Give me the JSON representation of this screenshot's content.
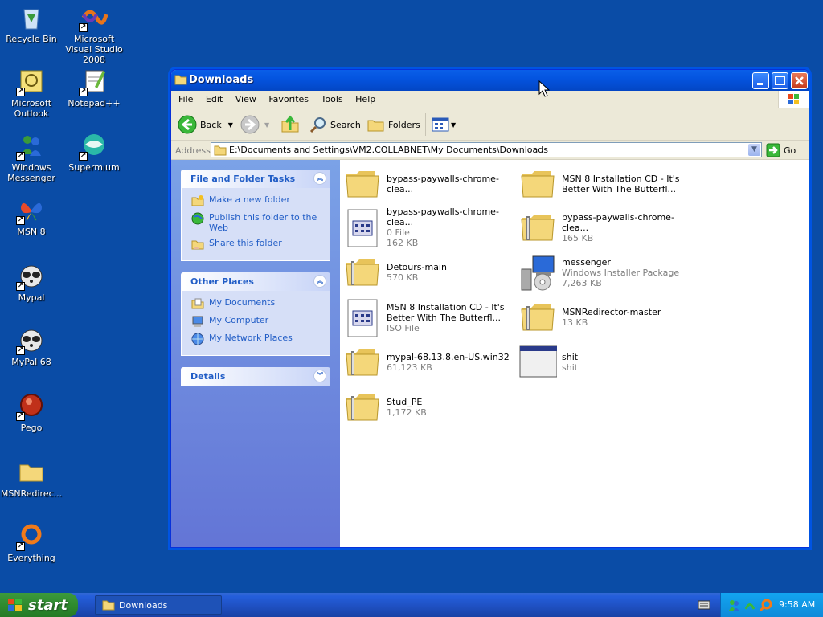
{
  "desktop": {
    "icons": [
      {
        "label": "Recycle Bin",
        "icon": "recycle-bin-icon"
      },
      {
        "label": "Microsoft Visual Studio 2008",
        "icon": "visual-studio-icon"
      },
      {
        "label": "Microsoft Outlook",
        "icon": "outlook-icon"
      },
      {
        "label": "Notepad++",
        "icon": "notepad-plus-plus-icon"
      },
      {
        "label": "Windows Messenger",
        "icon": "windows-messenger-icon"
      },
      {
        "label": "Supermium",
        "icon": "supermium-icon"
      },
      {
        "label": "MSN 8",
        "icon": "msn-butterfly-icon"
      },
      {
        "label": "Mypal",
        "icon": "mypal-raccoon-icon"
      },
      {
        "label": "MyPal 68",
        "icon": "mypal-raccoon-icon"
      },
      {
        "label": "Pego",
        "icon": "pego-icon"
      },
      {
        "label": "MSNRedirec...",
        "icon": "folder-icon"
      },
      {
        "label": "Everything",
        "icon": "everything-search-icon"
      }
    ]
  },
  "window": {
    "title": "Downloads",
    "menu": [
      "File",
      "Edit",
      "View",
      "Favorites",
      "Tools",
      "Help"
    ],
    "toolbar": {
      "back": "Back",
      "search": "Search",
      "folders": "Folders"
    },
    "address": {
      "label": "Address",
      "value": "E:\\Documents and Settings\\VM2.COLLABNET\\My Documents\\Downloads",
      "go": "Go"
    },
    "tasks_panel": {
      "title": "File and Folder Tasks",
      "items": [
        "Make a new folder",
        "Publish this folder to the Web",
        "Share this folder"
      ]
    },
    "places_panel": {
      "title": "Other Places",
      "items": [
        "My Documents",
        "My Computer",
        "My Network Places"
      ]
    },
    "details_panel": {
      "title": "Details"
    },
    "files": [
      {
        "name": "bypass-paywalls-chrome-clea...",
        "sub1": "",
        "sub2": "",
        "kind": "folder"
      },
      {
        "name": "MSN 8 Installation CD - It's",
        "name2": "Better With The Butterfl...",
        "sub1": "",
        "kind": "folder"
      },
      {
        "name": "bypass-paywalls-chrome-clea...",
        "sub1": "0 File",
        "sub2": "162 KB",
        "kind": "file"
      },
      {
        "name": "bypass-paywalls-chrome-clea...",
        "sub1": "165 KB",
        "kind": "zip"
      },
      {
        "name": "Detours-main",
        "sub1": "570 KB",
        "kind": "zip"
      },
      {
        "name": "messenger",
        "sub1": "Windows Installer Package",
        "sub2": "7,263 KB",
        "kind": "msi"
      },
      {
        "name": "MSN 8 Installation CD - It's",
        "name2": "Better With The Butterfl...",
        "sub1": "ISO File",
        "kind": "file"
      },
      {
        "name": "MSNRedirector-master",
        "sub1": "13 KB",
        "kind": "zip"
      },
      {
        "name": "mypal-68.13.8.en-US.win32",
        "sub1": "61,123 KB",
        "kind": "zip"
      },
      {
        "name": "shit",
        "sub1": "shit",
        "kind": "window"
      },
      {
        "name": "Stud_PE",
        "sub1": "1,172 KB",
        "kind": "zip"
      }
    ]
  },
  "taskbar": {
    "start": "start",
    "task": "Downloads",
    "clock": "9:58 AM"
  }
}
